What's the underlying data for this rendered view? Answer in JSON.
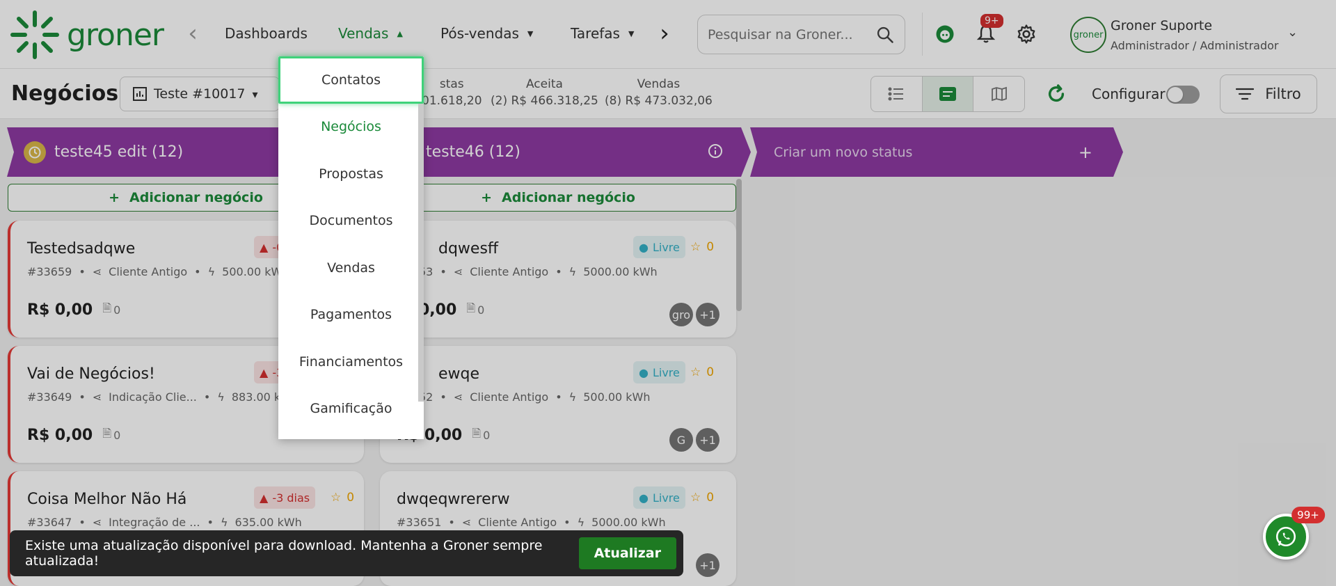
{
  "app": {
    "logo_text": "groner",
    "brand_color": "#1b8a3a"
  },
  "nav": {
    "items": [
      {
        "label": "Dashboards"
      },
      {
        "label": "Vendas"
      },
      {
        "label": "Pós-vendas"
      },
      {
        "label": "Tarefas"
      }
    ],
    "search_placeholder": "Pesquisar na Groner...",
    "notification_badge": "9+",
    "user": {
      "name": "Groner Suporte",
      "role": "Administrador / Administrador",
      "avatar_text": "groner"
    }
  },
  "subheader": {
    "title": "Negócios",
    "pipeline": "Teste #10017",
    "stats": [
      {
        "label": "stas",
        "value": "01.618,20"
      },
      {
        "label": "Aceita",
        "value": "(2) R$ 466.318,25"
      },
      {
        "label": "Vendas",
        "value": "(8) R$ 473.032,06"
      }
    ],
    "configure_label": "Configurar",
    "filter_label": "Filtro"
  },
  "columns": [
    {
      "title": "teste45 edit (12)",
      "add_label": "Adicionar negócio"
    },
    {
      "title": "teste46 (12)",
      "add_label": "Adicionar negócio"
    },
    {
      "title": "Criar um novo status",
      "add_symbol": "+"
    }
  ],
  "cards": [
    {
      "title": "Testedsadqwe",
      "id": "#33659",
      "source": "Cliente Antigo",
      "energy": "500.00 kWh",
      "price": "R$ 0,00",
      "docs": "0",
      "tag": "-0"
    },
    {
      "title": "Vai de Negócios!",
      "id": "#33649",
      "source": "Indicação Clie...",
      "energy": "883.00 kWh",
      "price": "R$ 0,00",
      "docs": "0",
      "tag": "-3"
    },
    {
      "title": "Coisa Melhor Não Há",
      "id": "#33647",
      "source": "Integração de ...",
      "energy": "635.00 kWh",
      "tag": "-3 dias",
      "stars": "0"
    },
    {
      "title": "dqwesff",
      "id": "53",
      "source": "Cliente Antigo",
      "energy": "5000.00 kWh",
      "price": "0,00",
      "docs": "0",
      "tag": "Livre",
      "stars": "0",
      "avatar": "gro",
      "more": "+1"
    },
    {
      "title": "ewqe",
      "id": "52",
      "source": "Cliente Antigo",
      "energy": "500.00 kWh",
      "price": "R$ 0,00",
      "docs": "0",
      "tag": "Livre",
      "stars": "0",
      "avatar": "G",
      "more": "+1"
    },
    {
      "title": "dwqeqwrererw",
      "id": "#33651",
      "source": "Cliente Antigo",
      "energy": "5000.00 kWh",
      "tag": "Livre",
      "stars": "0",
      "more": "+1"
    }
  ],
  "dropdown": {
    "items": [
      "Contatos",
      "Negócios",
      "Propostas",
      "Documentos",
      "Vendas",
      "Pagamentos",
      "Financiamentos",
      "Gamificação"
    ]
  },
  "toast": {
    "message": "Existe uma atualização disponível para download. Mantenha a Groner sempre atualizada!",
    "action": "Atualizar"
  },
  "whatsapp": {
    "badge": "99+"
  }
}
